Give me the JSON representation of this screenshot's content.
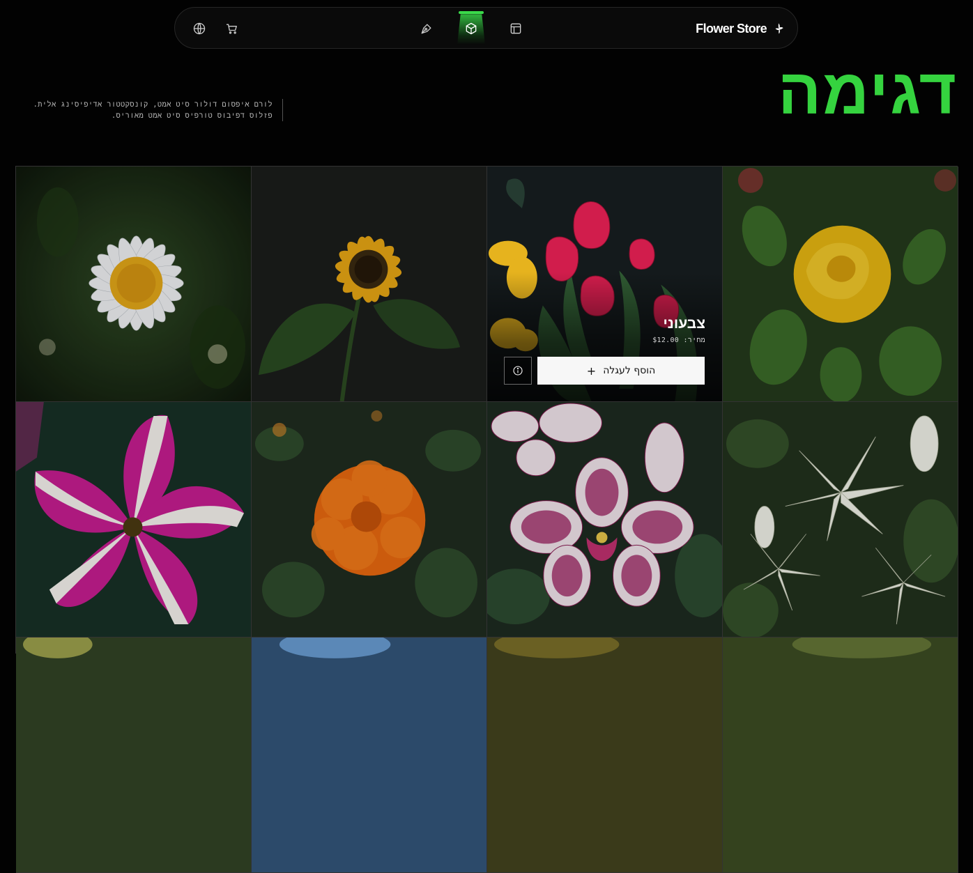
{
  "brand": {
    "name": "Flower Store"
  },
  "nav": {
    "icons": [
      "globe-icon",
      "cart-icon",
      "pen-tool-icon",
      "box-icon",
      "layout-icon"
    ],
    "active": "box-icon",
    "accent": "#3ad94a"
  },
  "hero": {
    "title": "דגימה",
    "description": "לורם איפסום דולור סיט אמט, קונסקטטור אדיפיסינג אלית. פזלוס דפיבוס טורפיס סיט אמט מאוריס."
  },
  "products": [
    {
      "id": "daisy",
      "flower": "daisy"
    },
    {
      "id": "sunflower",
      "flower": "sunflower"
    },
    {
      "id": "tulip",
      "flower": "tulip",
      "name": "צבעוני",
      "price": "מחיר: $12.00",
      "add_label": "הוסף לעגלה",
      "add_icon": "+"
    },
    {
      "id": "rose",
      "flower": "rose"
    },
    {
      "id": "petunia",
      "flower": "petunia"
    },
    {
      "id": "marigold",
      "flower": "marigold"
    },
    {
      "id": "orchid",
      "flower": "orchid"
    },
    {
      "id": "lily",
      "flower": "lily"
    }
  ]
}
